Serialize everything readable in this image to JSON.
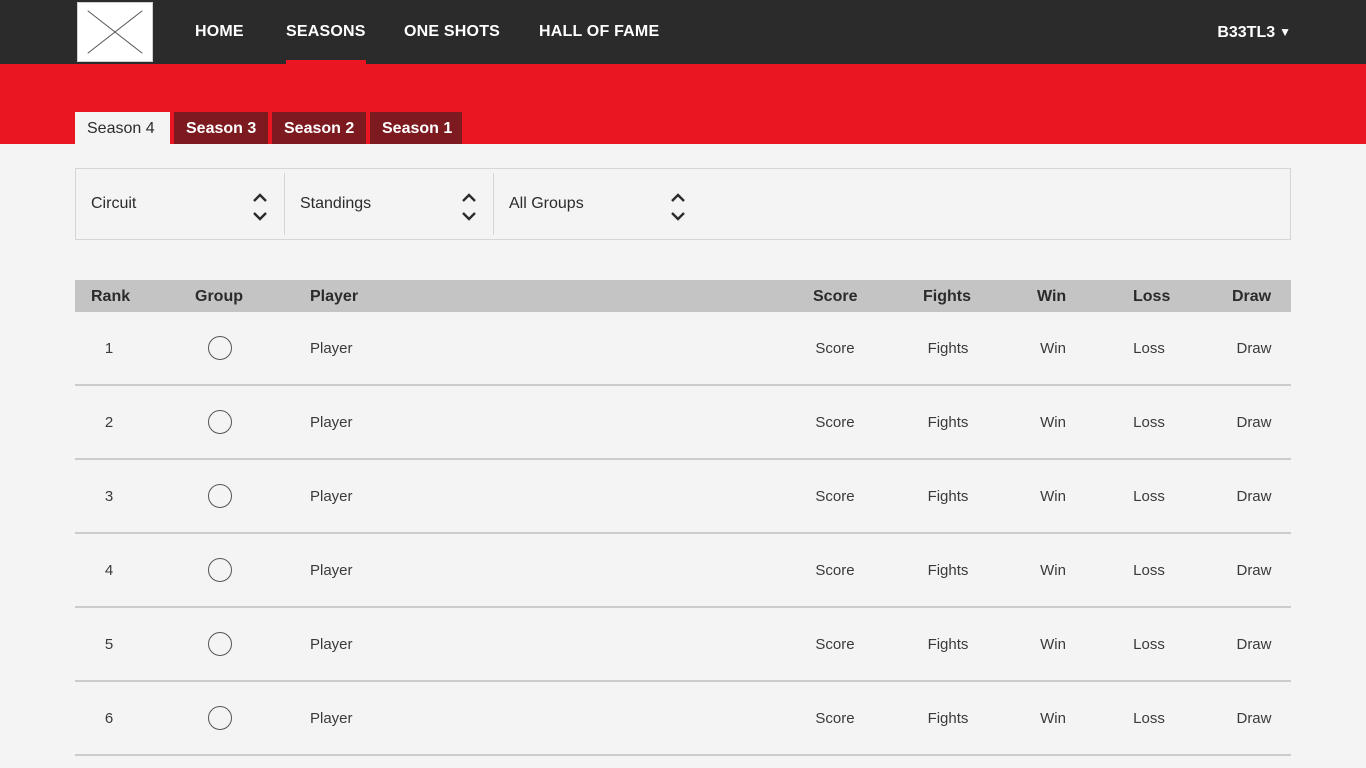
{
  "nav": {
    "logo_icon": "placeholder-image-icon",
    "items": [
      {
        "label": "HOME"
      },
      {
        "label": "SEASONS"
      },
      {
        "label": "ONE SHOTS"
      },
      {
        "label": "HALL OF FAME"
      }
    ],
    "active": "SEASONS",
    "user": {
      "label": "B33TL3",
      "icon": "caret-down-icon",
      "caret": "▼"
    }
  },
  "season_tabs": [
    {
      "label": "Season 4"
    },
    {
      "label": "Season 3"
    },
    {
      "label": "Season 2"
    },
    {
      "label": "Season 1"
    }
  ],
  "active_season": "Season 4",
  "filters": [
    {
      "selected": "Circuit",
      "icon": "sort-arrows-icon"
    },
    {
      "selected": "Standings",
      "icon": "sort-arrows-icon"
    },
    {
      "selected": "All Groups",
      "icon": "sort-arrows-icon"
    }
  ],
  "table": {
    "headers": {
      "rank": "Rank",
      "group": "Group",
      "player": "Player",
      "score": "Score",
      "fights": "Fights",
      "win": "Win",
      "loss": "Loss",
      "draw": "Draw"
    },
    "rows": [
      {
        "rank": "1",
        "player": "Player",
        "score": "Score",
        "fights": "Fights",
        "win": "Win",
        "loss": "Loss",
        "draw": "Draw"
      },
      {
        "rank": "2",
        "player": "Player",
        "score": "Score",
        "fights": "Fights",
        "win": "Win",
        "loss": "Loss",
        "draw": "Draw"
      },
      {
        "rank": "3",
        "player": "Player",
        "score": "Score",
        "fights": "Fights",
        "win": "Win",
        "loss": "Loss",
        "draw": "Draw"
      },
      {
        "rank": "4",
        "player": "Player",
        "score": "Score",
        "fights": "Fights",
        "win": "Win",
        "loss": "Loss",
        "draw": "Draw"
      },
      {
        "rank": "5",
        "player": "Player",
        "score": "Score",
        "fights": "Fights",
        "win": "Win",
        "loss": "Loss",
        "draw": "Draw"
      },
      {
        "rank": "6",
        "player": "Player",
        "score": "Score",
        "fights": "Fights",
        "win": "Win",
        "loss": "Loss",
        "draw": "Draw"
      }
    ]
  },
  "colors": {
    "topbar": "#2b2b2b",
    "accent_red": "#ea1723",
    "inactive_tab": "#7d1a20",
    "table_header": "#c4c4c4",
    "page_bg": "#f4f4f4"
  }
}
